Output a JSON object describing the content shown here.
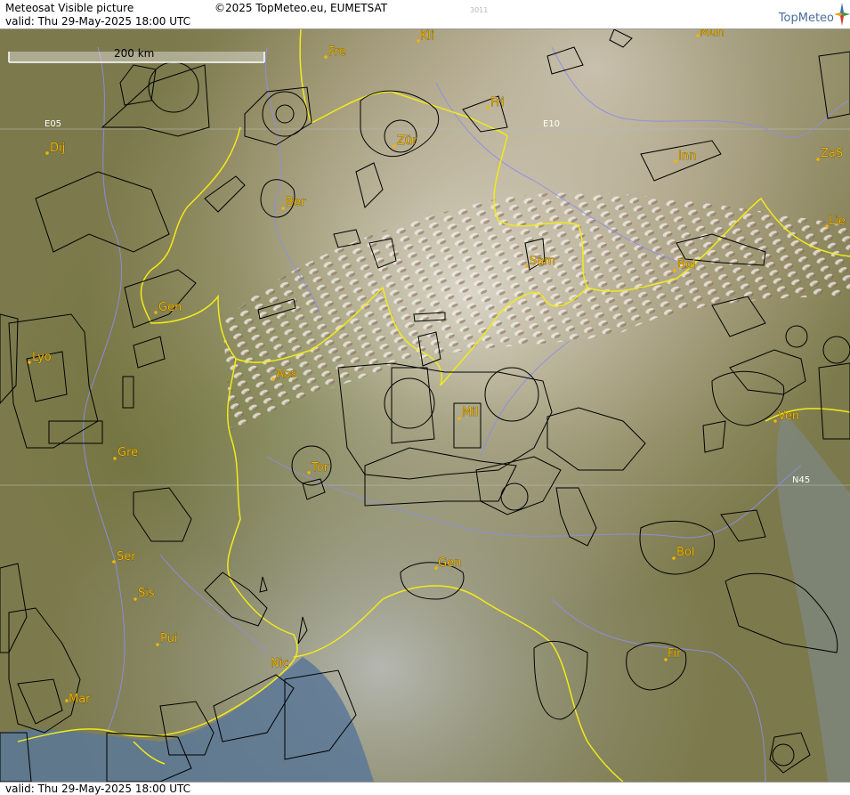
{
  "header": {
    "title": "Meteosat Visible picture",
    "valid": "valid:  Thu  29-May-2025  18:00 UTC",
    "copyright": "©2025 TopMeteo.eu, EUMETSAT",
    "tile_code": "3011",
    "brand": "TopMeteo"
  },
  "footer": {
    "valid": "valid:  Thu  29-May-2025  18:00 UTC"
  },
  "scale_bar": {
    "label": "200 km"
  },
  "grid_labels": {
    "e05": "E05",
    "e10": "E10",
    "n45": "N45"
  },
  "cities": {
    "kli": "Kli",
    "mun": "Mun",
    "fre": "Fre",
    "fri": "Fri",
    "zur": "Zür",
    "dij": "Dij",
    "inn": "Inn",
    "zas": "ZaS",
    "ber": "Ber",
    "lie": "Lie",
    "sam": "Sam",
    "bol_north": "Bol",
    "gen_north": "Gen",
    "lyo": "Lyo",
    "aos": "Aos",
    "mil": "Mil",
    "ven": "Ven",
    "gre": "Gre",
    "tor": "Tor",
    "ser": "Ser",
    "gen_south": "Gen",
    "bol_south": "Bol",
    "sis": "Sis",
    "pui": "Pui",
    "nic": "Nic",
    "fir": "Fir",
    "mar": "Mar"
  },
  "colors": {
    "city_label": "#f4b400",
    "border_line": "#f2ea1a",
    "airspace_line": "#000000",
    "river_line": "#8c8ee8",
    "sea": "#5b7896",
    "brand_text": "#4a6f9c"
  }
}
